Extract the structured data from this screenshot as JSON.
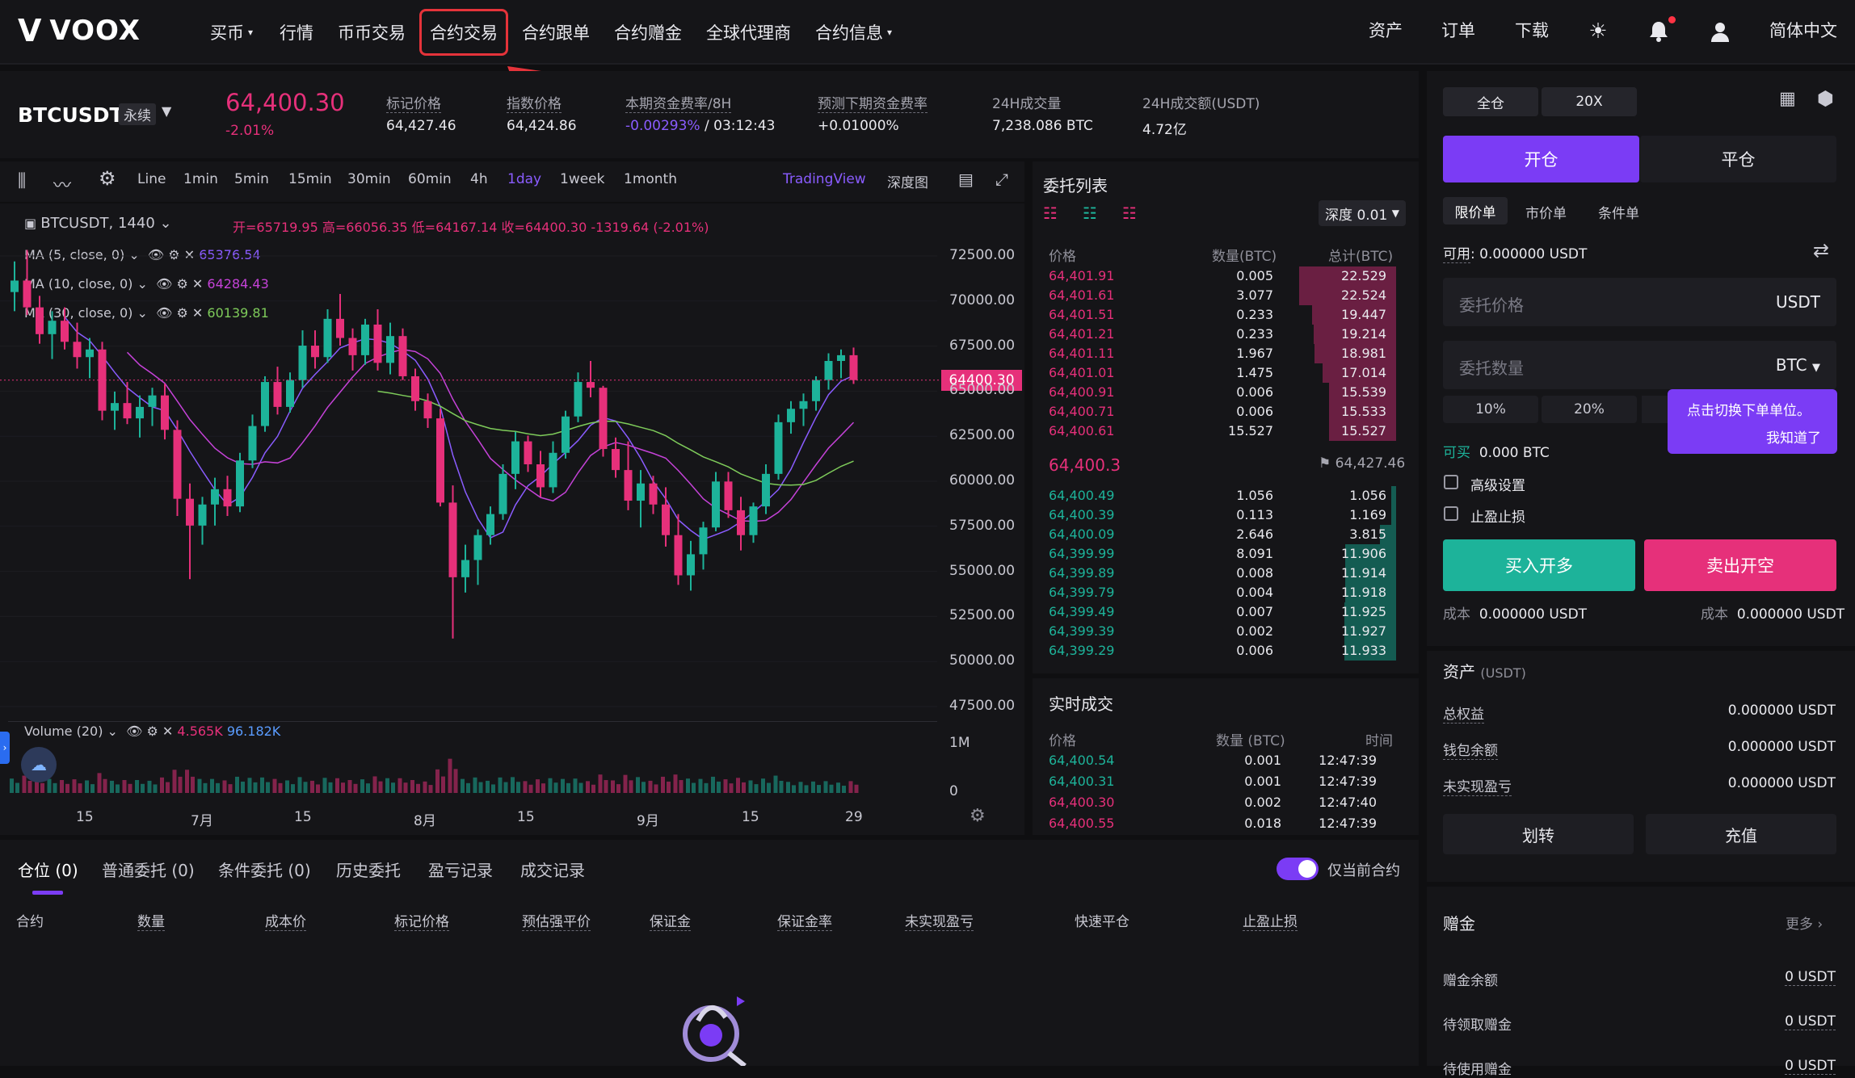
{
  "header": {
    "logo_text": "VOOX",
    "nav": [
      {
        "label": "买币",
        "dropdown": true
      },
      {
        "label": "行情"
      },
      {
        "label": "币币交易"
      },
      {
        "label": "合约交易",
        "active": true
      },
      {
        "label": "合约跟单"
      },
      {
        "label": "合约赠金"
      },
      {
        "label": "全球代理商"
      },
      {
        "label": "合约信息",
        "dropdown": true
      }
    ],
    "right": {
      "assets": "资产",
      "orders": "订单",
      "download": "下载",
      "language": "简体中文"
    }
  },
  "ticker": {
    "symbol": "BTCUSDT",
    "perpetual": "永续",
    "last_price": "64,400.30",
    "change_pct": "-2.01%",
    "mark_price_label": "标记价格",
    "mark_price": "64,427.46",
    "index_price_label": "指数价格",
    "index_price": "64,424.86",
    "funding_label": "本期资金费率/8H",
    "funding_rate": "-0.00293%",
    "funding_countdown": "/ 03:12:43",
    "next_funding_label": "预测下期资金费率",
    "next_funding": "+0.01000%",
    "vol_label": "24H成交量",
    "vol": "7,238.086 BTC",
    "turnover_label": "24H成交额(USDT)",
    "turnover": "4.72亿"
  },
  "chart": {
    "toolbar": {
      "intervals": [
        "Line",
        "1min",
        "5min",
        "15min",
        "30min",
        "60min",
        "4h",
        "1day",
        "1week",
        "1month"
      ],
      "active_interval": "1day",
      "tradingview": "TradingView",
      "depth": "深度图"
    },
    "legend": {
      "symbol": "BTCUSDT, 1440",
      "ohlc": "开=65719.95  高=66056.35  低=64167.14  收=64400.30  -1319.64 (-2.01%)",
      "ma1_label": "MA (5, close, 0)",
      "ma1_value": "65376.54",
      "ma2_label": "MA (10, close, 0)",
      "ma2_value": "64284.43",
      "ma3_label": "MA (30, close, 0)",
      "ma3_value": "60139.81",
      "volume_label": "Volume (20)",
      "vol_a": "4.565K",
      "vol_b": "96.182K"
    },
    "price_tag": "64400.30",
    "y_ticks": [
      "72500.00",
      "70000.00",
      "67500.00",
      "65000.00",
      "62500.00",
      "60000.00",
      "57500.00",
      "55000.00",
      "52500.00",
      "50000.00",
      "47500.00"
    ],
    "vol_ticks": [
      "1M",
      "0"
    ],
    "x_ticks": [
      "15",
      "7月",
      "15",
      "8月",
      "15",
      "9月",
      "15",
      "29"
    ]
  },
  "chart_data": {
    "type": "candlestick",
    "ylim": [
      46500,
      73500
    ],
    "candles": [
      [
        69000,
        70600,
        68000,
        69600
      ],
      [
        69600,
        71200,
        67800,
        68200
      ],
      [
        68200,
        68800,
        66300,
        66800
      ],
      [
        66800,
        68000,
        65500,
        67500
      ],
      [
        67500,
        68200,
        66000,
        66400
      ],
      [
        66400,
        67400,
        65000,
        65600
      ],
      [
        65600,
        66600,
        64500,
        66000
      ],
      [
        66000,
        66400,
        62300,
        62800
      ],
      [
        62800,
        63800,
        61800,
        63200
      ],
      [
        63200,
        64300,
        62100,
        62400
      ],
      [
        62400,
        63600,
        61400,
        63000
      ],
      [
        63000,
        64000,
        62000,
        63600
      ],
      [
        63600,
        64200,
        61300,
        61800
      ],
      [
        61800,
        62300,
        57300,
        58200
      ],
      [
        58200,
        59000,
        54000,
        56800
      ],
      [
        56800,
        58300,
        55800,
        57900
      ],
      [
        57900,
        59300,
        56800,
        58700
      ],
      [
        58700,
        59400,
        57300,
        57800
      ],
      [
        57800,
        60600,
        57500,
        60200
      ],
      [
        60200,
        62600,
        59800,
        62000
      ],
      [
        62000,
        64600,
        61700,
        64300
      ],
      [
        64300,
        65100,
        62600,
        63000
      ],
      [
        63000,
        64800,
        62700,
        64400
      ],
      [
        64400,
        67000,
        64000,
        66200
      ],
      [
        66200,
        67000,
        65000,
        65600
      ],
      [
        65600,
        68100,
        65300,
        67600
      ],
      [
        67600,
        68900,
        66200,
        66600
      ],
      [
        66600,
        67100,
        64900,
        65700
      ],
      [
        65700,
        67600,
        65200,
        67300
      ],
      [
        67300,
        68100,
        64900,
        65300
      ],
      [
        65300,
        67400,
        64700,
        66700
      ],
      [
        66700,
        67100,
        64400,
        64600
      ],
      [
        64600,
        65000,
        62800,
        63300
      ],
      [
        63300,
        63700,
        61900,
        62400
      ],
      [
        62400,
        62900,
        57800,
        58000
      ],
      [
        58000,
        58900,
        50900,
        54100
      ],
      [
        54100,
        55800,
        53300,
        55000
      ],
      [
        55000,
        56600,
        53700,
        56300
      ],
      [
        56300,
        57800,
        55800,
        57400
      ],
      [
        57400,
        60000,
        57100,
        59500
      ],
      [
        59500,
        61700,
        58700,
        61200
      ],
      [
        61200,
        61500,
        59600,
        60000
      ],
      [
        60000,
        60700,
        58300,
        58800
      ],
      [
        58800,
        61200,
        58500,
        60600
      ],
      [
        60600,
        62800,
        60300,
        62500
      ],
      [
        62500,
        64800,
        62200,
        64300
      ],
      [
        64300,
        65400,
        63500,
        64000
      ],
      [
        64000,
        64100,
        60400,
        60800
      ],
      [
        60800,
        61400,
        59300,
        59700
      ],
      [
        59700,
        61200,
        57600,
        58100
      ],
      [
        58100,
        59700,
        56700,
        59000
      ],
      [
        59000,
        59400,
        57400,
        57900
      ],
      [
        57900,
        58800,
        55700,
        56300
      ],
      [
        56300,
        57400,
        53700,
        54200
      ],
      [
        54200,
        56000,
        53400,
        55300
      ],
      [
        55300,
        57000,
        54500,
        56700
      ],
      [
        56700,
        59600,
        56500,
        59100
      ],
      [
        59100,
        59600,
        57200,
        57600
      ],
      [
        57600,
        58300,
        55500,
        56300
      ],
      [
        56300,
        58000,
        55900,
        57800
      ],
      [
        57800,
        60000,
        57400,
        59500
      ],
      [
        59500,
        62600,
        59200,
        62200
      ],
      [
        62200,
        63300,
        61600,
        62900
      ],
      [
        62900,
        63700,
        62000,
        63300
      ],
      [
        63300,
        64600,
        62800,
        64400
      ],
      [
        64400,
        65800,
        63900,
        65400
      ],
      [
        65400,
        66000,
        64500,
        65700
      ],
      [
        65700,
        66100,
        64200,
        64400
      ]
    ]
  },
  "orderbook": {
    "title": "委托列表",
    "depth_select": "深度 0.01",
    "headers": [
      "价格",
      "数量(BTC)",
      "总计(BTC)"
    ],
    "asks": [
      [
        "64,401.91",
        "0.005",
        "22.529"
      ],
      [
        "64,401.61",
        "3.077",
        "22.524"
      ],
      [
        "64,401.51",
        "0.233",
        "19.447"
      ],
      [
        "64,401.21",
        "0.233",
        "19.214"
      ],
      [
        "64,401.11",
        "1.967",
        "18.981"
      ],
      [
        "64,401.01",
        "1.475",
        "17.014"
      ],
      [
        "64,400.91",
        "0.006",
        "15.539"
      ],
      [
        "64,400.71",
        "0.006",
        "15.533"
      ],
      [
        "64,400.61",
        "15.527",
        "15.527"
      ]
    ],
    "mid_price": "64,400.3",
    "mark_price": "64,427.46",
    "bids": [
      [
        "64,400.49",
        "1.056",
        "1.056"
      ],
      [
        "64,400.39",
        "0.113",
        "1.169"
      ],
      [
        "64,400.09",
        "2.646",
        "3.815"
      ],
      [
        "64,399.99",
        "8.091",
        "11.906"
      ],
      [
        "64,399.89",
        "0.008",
        "11.914"
      ],
      [
        "64,399.79",
        "0.004",
        "11.918"
      ],
      [
        "64,399.49",
        "0.007",
        "11.925"
      ],
      [
        "64,399.39",
        "0.002",
        "11.927"
      ],
      [
        "64,399.29",
        "0.006",
        "11.933"
      ]
    ]
  },
  "trades": {
    "title": "实时成交",
    "headers": [
      "价格",
      "数量 (BTC)",
      "时间"
    ],
    "rows": [
      [
        "64,400.54",
        "0.001",
        "12:47:39",
        "buy"
      ],
      [
        "64,400.31",
        "0.001",
        "12:47:39",
        "buy"
      ],
      [
        "64,400.30",
        "0.002",
        "12:47:40",
        "sell"
      ],
      [
        "64,400.55",
        "0.018",
        "12:47:39",
        "sell"
      ]
    ]
  },
  "positions": {
    "tabs": [
      "仓位 (0)",
      "普通委托 (0)",
      "条件委托 (0)",
      "历史委托",
      "盈亏记录",
      "成交记录"
    ],
    "only_current": "仅当前合约",
    "columns": [
      "合约",
      "数量",
      "成本价",
      "标记价格",
      "预估强平价",
      "保证金",
      "保证金率",
      "未实现盈亏",
      "快速平仓",
      "止盈止损"
    ]
  },
  "order_form": {
    "margin_mode": "全仓",
    "leverage": "20X",
    "open_tab": "开仓",
    "close_tab": "平仓",
    "order_types": [
      "限价单",
      "市价单",
      "条件单"
    ],
    "available_label": "可用",
    "available": ": 0.000000 USDT",
    "price_placeholder": "委托价格",
    "price_unit": "USDT",
    "qty_placeholder": "委托数量",
    "qty_unit": "BTC",
    "pcts": [
      "10%",
      "20%"
    ],
    "tooltip_line1": "点击切换下单单位。",
    "tooltip_line2": "我知道了",
    "can_buy_label": "可买",
    "can_buy": "0.000 BTC",
    "advanced": "高级设置",
    "tpsl": "止盈止损",
    "buy_btn": "买入开多",
    "sell_btn": "卖出开空",
    "cost_label": "成本",
    "cost_buy": "0.000000 USDT",
    "cost_sell": "0.000000 USDT"
  },
  "assets": {
    "title": "资产",
    "unit": "(USDT)",
    "rows": [
      [
        "总权益",
        "0.000000 USDT"
      ],
      [
        "钱包余额",
        "0.000000 USDT"
      ],
      [
        "未实现盈亏",
        "0.000000 USDT"
      ]
    ],
    "transfer": "划转",
    "deposit": "充值"
  },
  "bonus": {
    "title": "赠金",
    "more": "更多",
    "rows": [
      [
        "赠金余额",
        "0 USDT"
      ],
      [
        "待领取赠金",
        "0 USDT"
      ],
      [
        "待使用赠金",
        "0 USDT"
      ]
    ]
  },
  "colors": {
    "up": "#1db39a",
    "down": "#e6307a",
    "accent": "#7b3cf5"
  }
}
